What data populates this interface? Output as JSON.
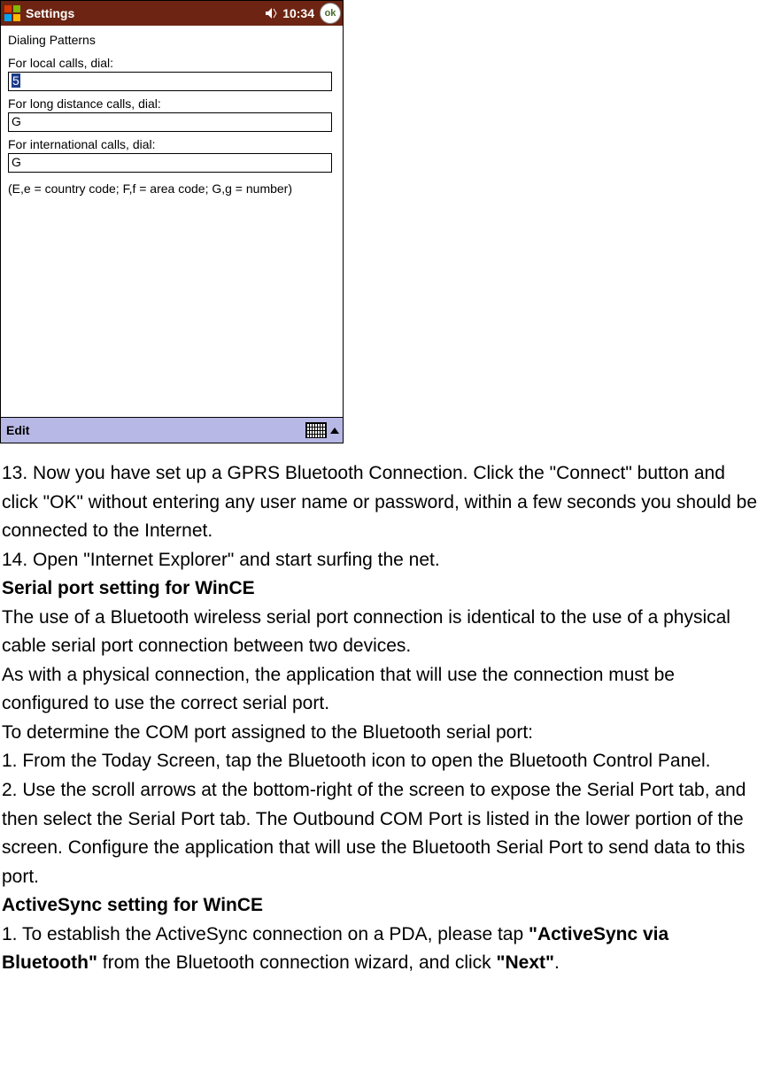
{
  "screenshot": {
    "titlebar": {
      "title": "Settings",
      "time": "10:34",
      "ok_label": "ok"
    },
    "heading": "Dialing Patterns",
    "fields": {
      "local_label": "For local calls, dial:",
      "local_value": "5",
      "long_label": "For long distance calls, dial:",
      "long_value": "G",
      "intl_label": "For international calls, dial:",
      "intl_value": "G"
    },
    "hint": "(E,e = country code; F,f = area code; G,g = number)",
    "bottombar": {
      "edit_label": "Edit"
    }
  },
  "body": {
    "p1": "13. Now you have set up a GPRS Bluetooth Connection. Click the \"Connect\" button and click \"OK\" without entering any user name or password, within a few seconds you should be connected to the Internet.",
    "p2": "14. Open \"Internet Explorer\" and start surfing the net.",
    "h1": "Serial port setting for WinCE",
    "p3": "The use of a Bluetooth wireless serial port connection is identical to the use of a physical cable serial port connection between two devices.",
    "p4": "As with a physical connection, the application that will use the connection must be configured to use the correct serial port.",
    "p5": "To determine the COM port assigned to the Bluetooth serial port:",
    "p6": "1. From the Today Screen, tap the Bluetooth icon to open the Bluetooth Control Panel.",
    "p7": "2. Use the scroll arrows at the bottom-right of the screen to expose the Serial Port tab, and then select the Serial Port tab. The Outbound COM Port is listed in the lower portion of the screen. Configure the application that will use the Bluetooth Serial Port to send data to this port.",
    "h2": "ActiveSync setting for WinCE",
    "p8a": "1. To establish the ActiveSync connection on a PDA, please tap ",
    "p8b": "\"ActiveSync via Bluetooth\"",
    "p8c": " from the Bluetooth connection wizard, and click ",
    "p8d": "\"Next\"",
    "p8e": "."
  }
}
